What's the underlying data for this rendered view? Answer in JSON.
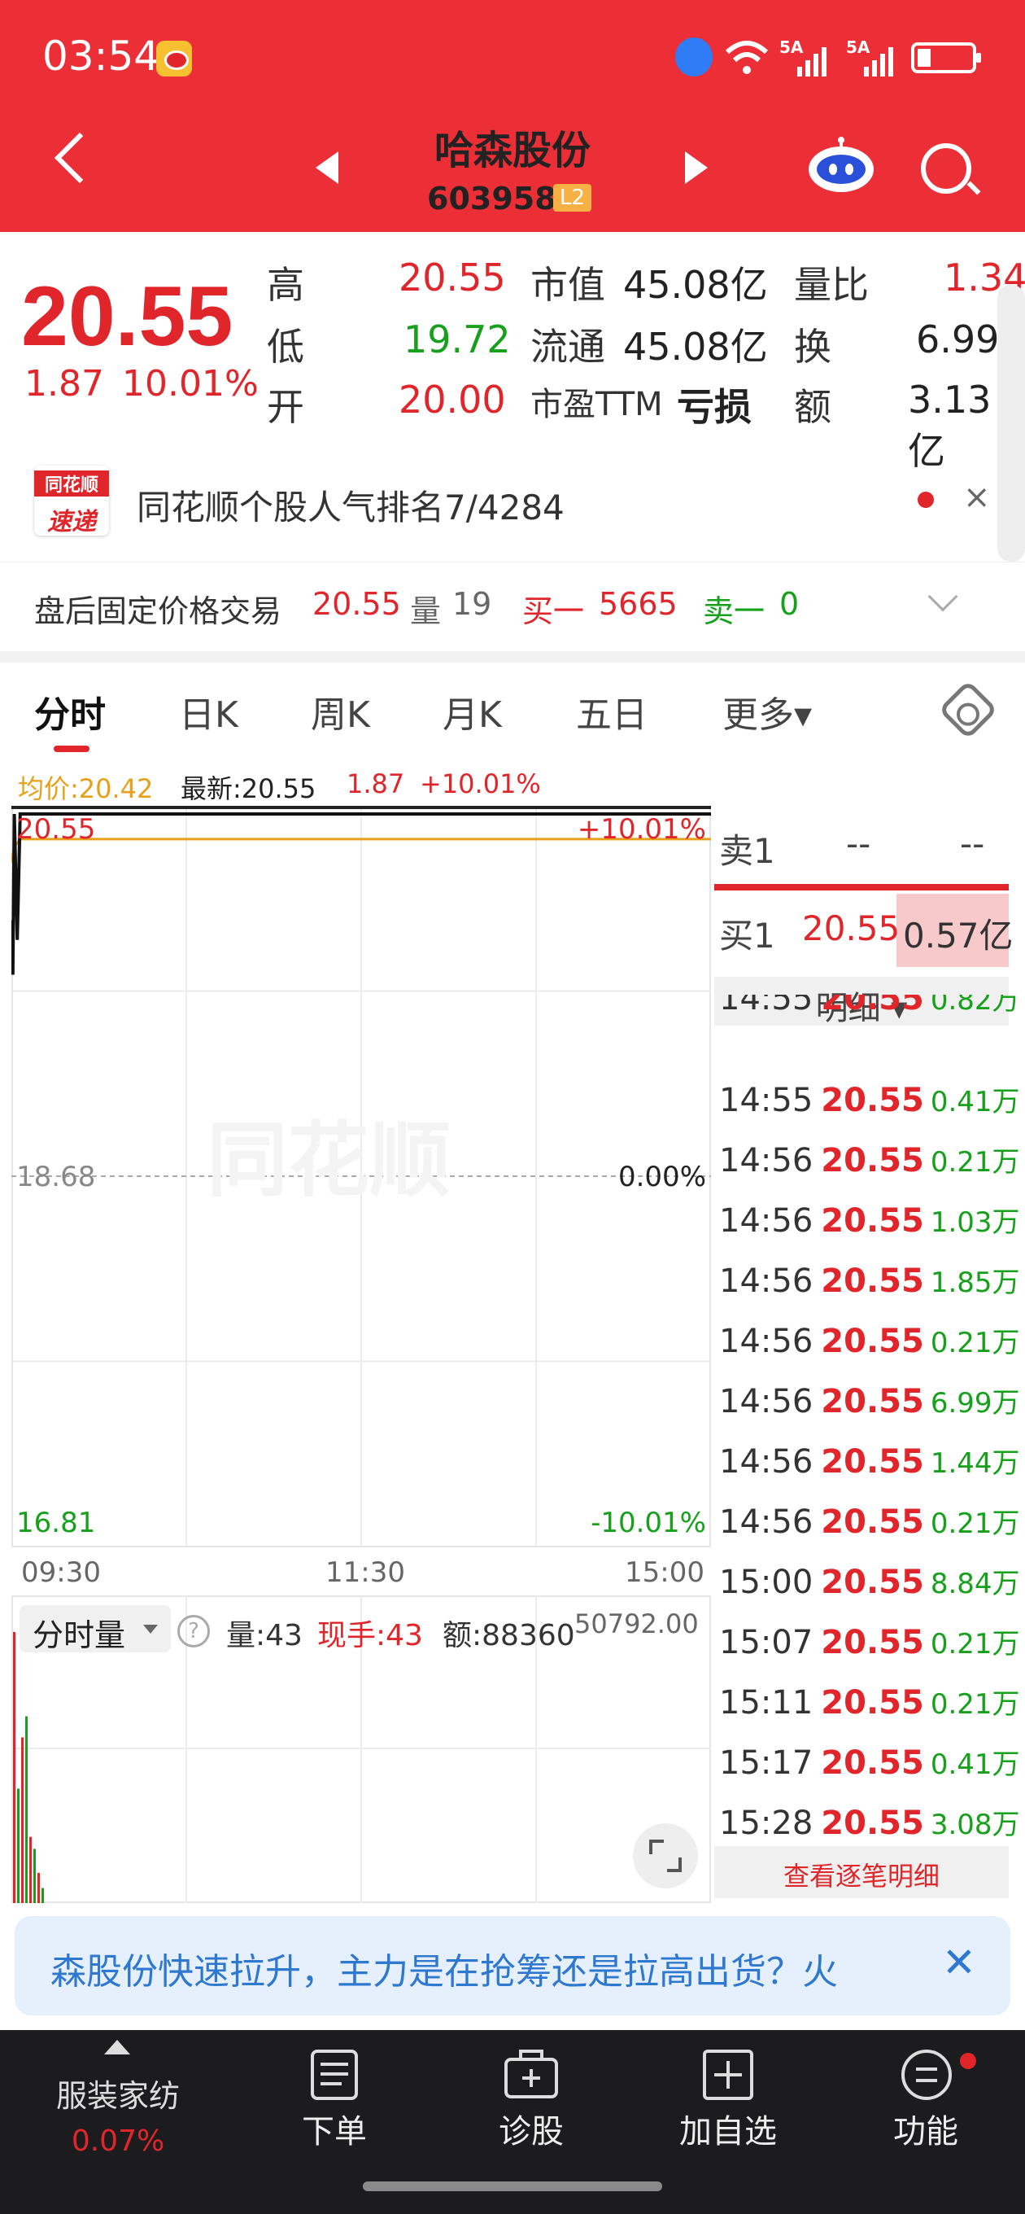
{
  "status_bar": {
    "time": "03:54",
    "net1": "5A",
    "net2": "5A"
  },
  "header": {
    "title": "哈森股份",
    "code": "603958",
    "level_badge": "L2"
  },
  "quote": {
    "price": "20.55",
    "change": "1.87",
    "change_pct": "10.01%",
    "rows": [
      {
        "l1": "高",
        "v1": "20.55",
        "l2": "市值",
        "v2": "45.08亿",
        "l3": "量比",
        "v3": "1.34"
      },
      {
        "l1": "低",
        "v1": "19.72",
        "l2": "流通",
        "v2": "45.08亿",
        "l3": "换",
        "v3": "6.99%"
      },
      {
        "l1": "开",
        "v1": "20.00",
        "l2": "市盈TTM",
        "v2": "亏损",
        "l3": "额",
        "v3": "3.13亿"
      }
    ]
  },
  "news": {
    "logo_top": "同花顺",
    "logo_bottom": "速递",
    "text": "同花顺个股人气排名7/4284",
    "close": "×"
  },
  "after_hours": {
    "label": "盘后固定价格交易",
    "price": "20.55",
    "vol_label": "量",
    "vol": "19",
    "buy_label": "买一",
    "buy": "5665",
    "sell_label": "卖一",
    "sell": "0"
  },
  "tabs": [
    "分时",
    "日K",
    "周K",
    "月K",
    "五日",
    "更多▾"
  ],
  "indicator": {
    "avg": "均价:20.42",
    "latest": "最新:20.55",
    "chg": "1.87",
    "pct": "+10.01%"
  },
  "chart_data": {
    "type": "line",
    "title": "",
    "x_ticks": [
      "09:30",
      "11:30",
      "15:00"
    ],
    "y_left": [
      "20.55",
      "18.68",
      "16.81"
    ],
    "y_right": [
      "+10.01%",
      "0.00%",
      "-10.01%"
    ],
    "ylim": [
      16.81,
      20.55
    ],
    "prev_close": 18.68,
    "series": [
      {
        "name": "最新",
        "color": "#111111",
        "x": [
          0,
          0.5,
          1,
          2,
          3,
          240
        ],
        "y": [
          20.0,
          19.72,
          20.55,
          19.9,
          20.55,
          20.55
        ]
      },
      {
        "name": "均价",
        "color": "#e8a01a",
        "x": [
          0,
          1,
          3,
          60,
          240
        ],
        "y": [
          20.3,
          20.38,
          20.42,
          20.42,
          20.42
        ]
      }
    ],
    "watermark": "同花顺"
  },
  "volume": {
    "selector": "分时量",
    "help": "?",
    "vol": "量:43",
    "now_hand": "现手:43",
    "amount": "额:88360",
    "max": "50792.00"
  },
  "order_book": {
    "ask_label": "卖1",
    "ask_price": "--",
    "ask_vol": "--",
    "bid_label": "买1",
    "bid_price": "20.55",
    "bid_vol": "0.57亿",
    "detail_label": "明细 ▾",
    "ticks": [
      {
        "t": "14:55",
        "p": "20.55",
        "v": "0.82万"
      },
      {
        "t": "14:55",
        "p": "20.55",
        "v": "0.41万"
      },
      {
        "t": "14:56",
        "p": "20.55",
        "v": "0.21万"
      },
      {
        "t": "14:56",
        "p": "20.55",
        "v": "1.03万"
      },
      {
        "t": "14:56",
        "p": "20.55",
        "v": "1.85万"
      },
      {
        "t": "14:56",
        "p": "20.55",
        "v": "0.21万"
      },
      {
        "t": "14:56",
        "p": "20.55",
        "v": "6.99万"
      },
      {
        "t": "14:56",
        "p": "20.55",
        "v": "1.44万"
      },
      {
        "t": "14:56",
        "p": "20.55",
        "v": "0.21万"
      },
      {
        "t": "15:00",
        "p": "20.55",
        "v": "8.84万"
      },
      {
        "t": "15:07",
        "p": "20.55",
        "v": "0.21万"
      },
      {
        "t": "15:11",
        "p": "20.55",
        "v": "0.21万"
      },
      {
        "t": "15:17",
        "p": "20.55",
        "v": "0.41万"
      },
      {
        "t": "15:28",
        "p": "20.55",
        "v": "3.08万"
      }
    ],
    "view_all": "查看逐笔明细"
  },
  "ad": {
    "text": "森股份快速拉升，主力是在抢筹还是拉高出货？火",
    "close": "✕"
  },
  "bottom_bar": {
    "sector": "服装家纺",
    "sector_chg": "0.07%",
    "items": [
      "下单",
      "诊股",
      "加自选",
      "功能"
    ]
  }
}
